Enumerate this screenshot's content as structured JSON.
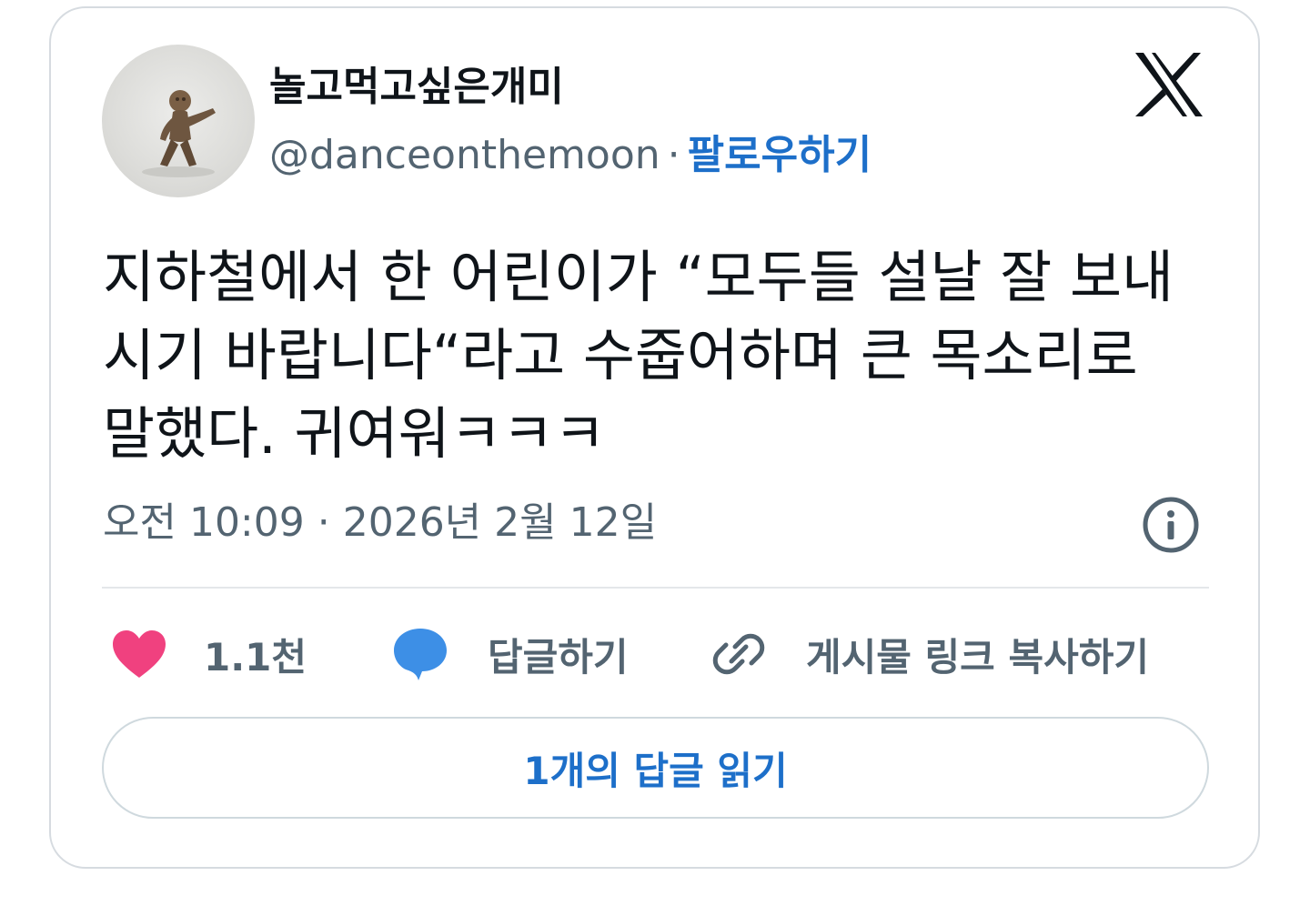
{
  "author": {
    "display_name": "놀고먹고싶은개미",
    "handle": "@danceonthemoon",
    "separator": "·",
    "follow_label": "팔로우하기"
  },
  "tweet": {
    "text": "지하철에서 한 어린이가 “모두들 설날 잘 보내\n시기 바랍니다“라고 수줍어하며 큰 목소리로\n말했다. 귀여워ㅋㅋㅋ",
    "timestamp": "오전 10:09 · 2026년 2월 12일"
  },
  "actions": {
    "like_count": "1.1천",
    "reply_label": "답글하기",
    "copy_link_label": "게시물 링크 복사하기"
  },
  "read_replies_label": "1개의 답글 읽기",
  "colors": {
    "accent": "#1d6fc9",
    "like": "#f0417f",
    "reply": "#3d8fe6",
    "text": "#0f1419",
    "muted": "#536471"
  },
  "icons": [
    "x-logo-icon",
    "info-icon",
    "heart-icon",
    "speech-bubble-icon",
    "link-icon"
  ]
}
